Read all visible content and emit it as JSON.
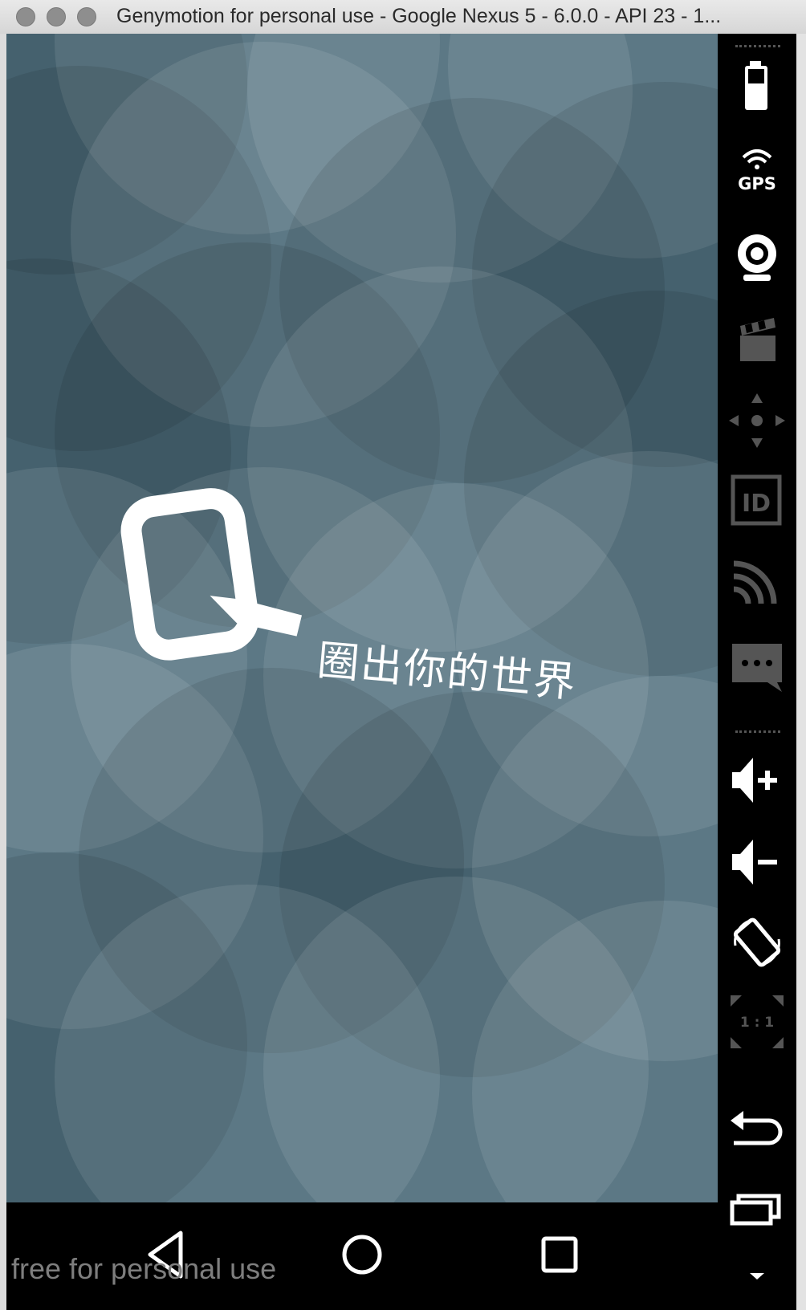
{
  "window": {
    "title": "Genymotion for personal use - Google Nexus 5 - 6.0.0 - API 23 - 1..."
  },
  "app": {
    "logo_letter": "Q",
    "slogan": "圈出你的世界",
    "colors": {
      "background": "#4f6d7c",
      "logo": "#ffffff",
      "slogan": "#ffffff"
    }
  },
  "navbar": {
    "back_icon": "back-triangle-icon",
    "home_icon": "home-circle-icon",
    "recents_icon": "recents-square-icon"
  },
  "watermark": "free for personal use",
  "toolbar": {
    "items": [
      {
        "icon": "battery-icon"
      },
      {
        "icon": "gps-icon",
        "label": "GPS"
      },
      {
        "icon": "webcam-icon"
      },
      {
        "icon": "screencast-icon"
      },
      {
        "icon": "dpad-icon"
      },
      {
        "icon": "device-id-icon",
        "label": "ID"
      },
      {
        "icon": "network-icon"
      },
      {
        "icon": "sms-icon"
      },
      {
        "icon": "volume-up-icon"
      },
      {
        "icon": "volume-down-icon"
      },
      {
        "icon": "rotate-icon"
      },
      {
        "icon": "pixel-perfect-icon",
        "label": "1 : 1"
      },
      {
        "icon": "back-arrow-icon"
      },
      {
        "icon": "recent-apps-icon"
      },
      {
        "icon": "menu-down-icon"
      }
    ]
  }
}
